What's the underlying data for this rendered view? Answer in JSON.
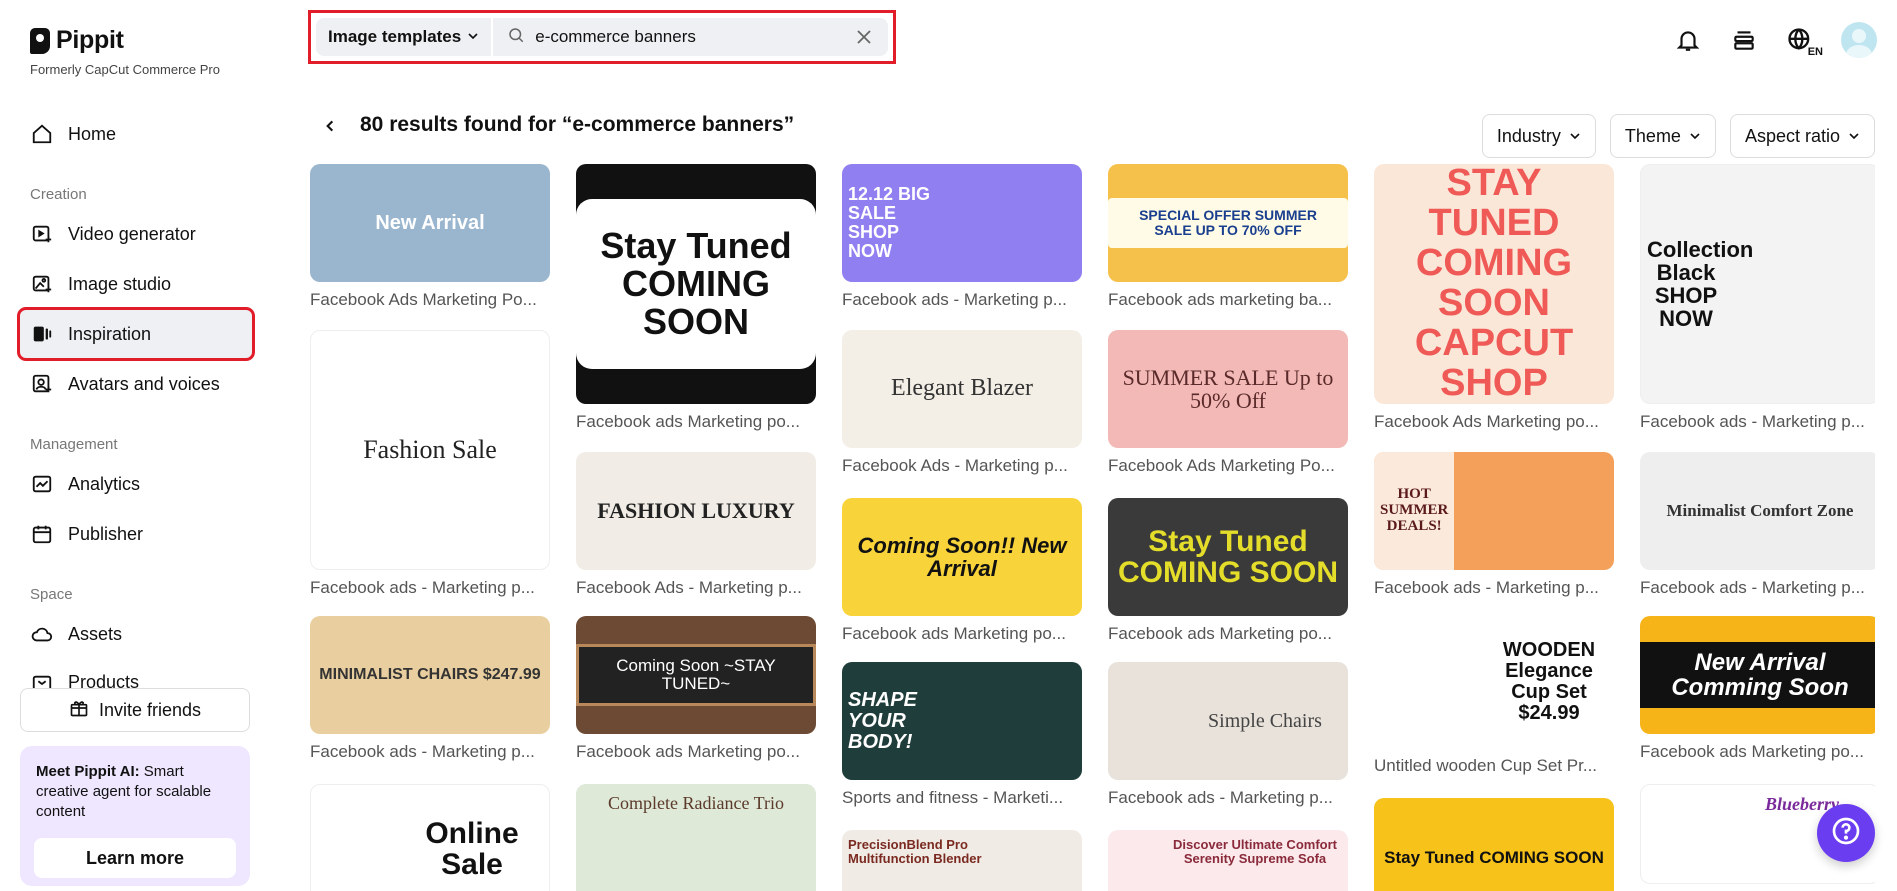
{
  "brand": {
    "name": "Pippit",
    "subtitle": "Formerly CapCut Commerce Pro"
  },
  "nav": {
    "home": "Home",
    "section_creation": "Creation",
    "video_generator": "Video generator",
    "image_studio": "Image studio",
    "inspiration": "Inspiration",
    "avatars_voices": "Avatars and voices",
    "section_management": "Management",
    "analytics": "Analytics",
    "publisher": "Publisher",
    "section_space": "Space",
    "assets": "Assets",
    "products": "Products"
  },
  "invite_label": "Invite friends",
  "ai_card": {
    "title": "Meet Pippit AI:",
    "text": " Smart creative agent for scalable content",
    "button": "Learn more"
  },
  "search": {
    "type_label": "Image templates",
    "query": "e-commerce banners"
  },
  "top_bar": {
    "lang_badge": "EN"
  },
  "results": {
    "title": "80 results found for “e-commerce banners”"
  },
  "filters": {
    "industry": "Industry",
    "theme": "Theme",
    "aspect": "Aspect ratio"
  },
  "templates": {
    "c0": [
      {
        "caption": "Facebook Ads Marketing Po...",
        "thumb_text": "New Arrival",
        "bg": "#9ab6cf",
        "fg": "#ffffff"
      },
      {
        "caption": "Facebook ads - Marketing p...",
        "thumb_text": "Fashion Sale",
        "bg": "#ffffff",
        "fg": "#222222"
      },
      {
        "caption": "Facebook ads - Marketing p...",
        "thumb_text": "MINIMALIST CHAIRS $247.99",
        "bg": "#e9cf9f",
        "fg": "#333333"
      },
      {
        "caption": "",
        "thumb_text": "Online Sale",
        "bg": "#ffffff",
        "fg": "#111111"
      }
    ],
    "c1": [
      {
        "caption": "Facebook ads Marketing po...",
        "thumb_text": "Stay Tuned COMING SOON",
        "bg": "#111111",
        "fg": "#ffffff"
      },
      {
        "caption": "Facebook Ads - Marketing p...",
        "thumb_text": "FASHION LUXURY",
        "bg": "#f1ede6",
        "fg": "#222222"
      },
      {
        "caption": "Facebook ads Marketing po...",
        "thumb_text": "Coming Soon ~STAY TUNED~",
        "bg": "#6d4a33",
        "fg": "#ffffff"
      },
      {
        "caption": "",
        "thumb_text": "Complete Radiance Trio",
        "bg": "#dfe9d8",
        "fg": "#5b3a2a"
      }
    ],
    "c2": [
      {
        "caption": "Facebook ads - Marketing p...",
        "thumb_text": "12.12 BIG SALE SHOP NOW",
        "bg": "#8f7ff0",
        "fg": "#ffffff"
      },
      {
        "caption": "Facebook Ads - Marketing p...",
        "thumb_text": "Elegant Blazer",
        "bg": "#f3efe6",
        "fg": "#333333"
      },
      {
        "caption": "Facebook ads Marketing po...",
        "thumb_text": "Coming Soon!! New Arrival",
        "bg": "#f8d33a",
        "fg": "#111111"
      },
      {
        "caption": "Sports and fitness - Marketi...",
        "thumb_text": "SHAPE YOUR BODY!",
        "bg": "#1f3d3a",
        "fg": "#ffffff"
      },
      {
        "caption": "",
        "thumb_text": "PrecisionBlend Pro Multifunction Blender",
        "bg": "#f1ebe6",
        "fg": "#7a2a20"
      }
    ],
    "c3": [
      {
        "caption": "Facebook ads marketing ba...",
        "thumb_text": "SPECIAL OFFER SUMMER SALE UP TO 70% OFF",
        "bg": "#f6c14a",
        "fg": "#1a3f8f"
      },
      {
        "caption": "Facebook Ads Marketing Po...",
        "thumb_text": "SUMMER SALE Up to 50% Off",
        "bg": "#f2b9b6",
        "fg": "#5a2a2a"
      },
      {
        "caption": "Facebook ads Marketing po...",
        "thumb_text": "Stay Tuned COMING SOON",
        "bg": "#3a3a3a",
        "fg": "#e4dd2a"
      },
      {
        "caption": "Facebook ads - Marketing p...",
        "thumb_text": "Simple Chairs",
        "bg": "#e8e2da",
        "fg": "#444444"
      },
      {
        "caption": "",
        "thumb_text": "Discover Ultimate Comfort Serenity Supreme Sofa",
        "bg": "#fbe9ec",
        "fg": "#8a2a3a"
      }
    ],
    "c4": [
      {
        "caption": "Facebook Ads Marketing po...",
        "thumb_text": "STAY TUNED COMING SOON CAPCUT SHOP",
        "bg": "#fbe7d8",
        "fg": "#ef5a57"
      },
      {
        "caption": "Facebook ads - Marketing p...",
        "thumb_text": "HOT SUMMER DEALS!",
        "bg": "#f5a05a",
        "fg": "#5a1a1a"
      },
      {
        "caption": "Untitled wooden Cup Set Pr...",
        "thumb_text": "WOODEN Elegance Cup Set $24.99",
        "bg": "#ffffff",
        "fg": "#111111"
      },
      {
        "caption": "",
        "thumb_text": "Stay Tuned COMING SOON",
        "bg": "#f7c21a",
        "fg": "#111111"
      }
    ],
    "c5": [
      {
        "caption": "Facebook ads - Marketing p...",
        "thumb_text": "Collection Black SHOP NOW",
        "bg": "#f3f3f3",
        "fg": "#111111"
      },
      {
        "caption": "Facebook ads - Marketing p...",
        "thumb_text": "Minimalist Comfort Zone",
        "bg": "#eeeeee",
        "fg": "#333333"
      },
      {
        "caption": "Facebook ads Marketing po...",
        "thumb_text": "New Arrival Comming Soon",
        "bg": "#f7b418",
        "fg": "#ffffff"
      },
      {
        "caption": "",
        "thumb_text": "Blueberry",
        "bg": "#ffffff",
        "fg": "#7a2a9a"
      }
    ]
  }
}
